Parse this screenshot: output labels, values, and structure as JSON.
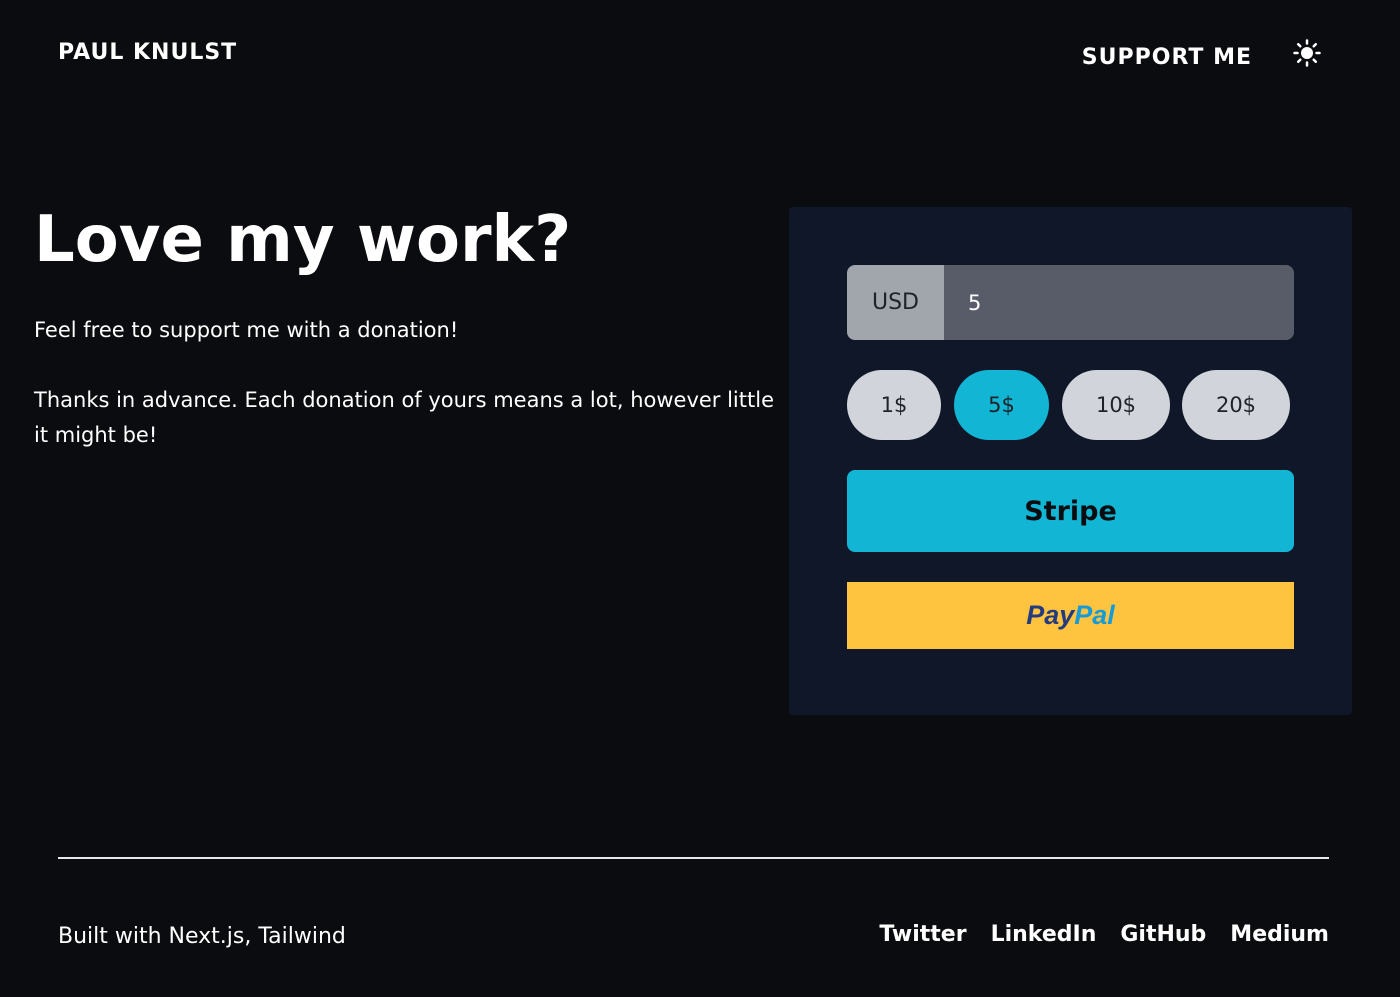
{
  "header": {
    "brand": "PAUL KNULST",
    "nav_support": "SUPPORT ME",
    "theme_icon": "sun-icon"
  },
  "hero": {
    "title": "Love my work?",
    "paragraph_1": "Feel free to support me with a donation!",
    "paragraph_2": "Thanks in advance. Each donation of yours means a lot, however little it might be!"
  },
  "donation": {
    "currency": "USD",
    "amount_value": "5",
    "presets": [
      {
        "label": "1$",
        "active": false
      },
      {
        "label": "5$",
        "active": true
      },
      {
        "label": "10$",
        "active": false
      },
      {
        "label": "20$",
        "active": false
      }
    ],
    "stripe_label": "Stripe",
    "paypal_pay": "Pay",
    "paypal_pal": "Pal"
  },
  "footer": {
    "built_with": "Built with Next.js, Tailwind",
    "links": [
      "Twitter",
      "LinkedIn",
      "GitHub",
      "Medium"
    ]
  },
  "colors": {
    "background": "#0b0c0f",
    "card": "#101729",
    "accent": "#12b5d4",
    "paypal_yellow": "#ffc43f"
  }
}
